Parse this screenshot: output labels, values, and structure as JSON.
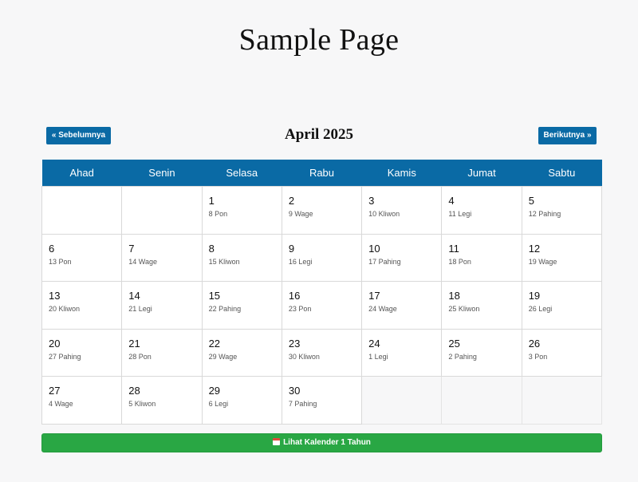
{
  "page": {
    "title": "Sample Page"
  },
  "nav": {
    "prev_label": "« Sebelumnya",
    "next_label": "Berikutnya »",
    "month_label": "April 2025"
  },
  "calendar": {
    "weekdays": [
      "Ahad",
      "Senin",
      "Selasa",
      "Rabu",
      "Kamis",
      "Jumat",
      "Sabtu"
    ],
    "weeks": [
      [
        null,
        null,
        {
          "day": "1",
          "pasaran": "8 Pon"
        },
        {
          "day": "2",
          "pasaran": "9 Wage"
        },
        {
          "day": "3",
          "pasaran": "10 Kliwon"
        },
        {
          "day": "4",
          "pasaran": "11 Legi"
        },
        {
          "day": "5",
          "pasaran": "12 Pahing"
        }
      ],
      [
        {
          "day": "6",
          "pasaran": "13 Pon"
        },
        {
          "day": "7",
          "pasaran": "14 Wage"
        },
        {
          "day": "8",
          "pasaran": "15 Kliwon"
        },
        {
          "day": "9",
          "pasaran": "16 Legi"
        },
        {
          "day": "10",
          "pasaran": "17 Pahing"
        },
        {
          "day": "11",
          "pasaran": "18 Pon"
        },
        {
          "day": "12",
          "pasaran": "19 Wage"
        }
      ],
      [
        {
          "day": "13",
          "pasaran": "20 Kliwon"
        },
        {
          "day": "14",
          "pasaran": "21 Legi"
        },
        {
          "day": "15",
          "pasaran": "22 Pahing"
        },
        {
          "day": "16",
          "pasaran": "23 Pon"
        },
        {
          "day": "17",
          "pasaran": "24 Wage"
        },
        {
          "day": "18",
          "pasaran": "25 Kliwon"
        },
        {
          "day": "19",
          "pasaran": "26 Legi"
        }
      ],
      [
        {
          "day": "20",
          "pasaran": "27 Pahing"
        },
        {
          "day": "21",
          "pasaran": "28 Pon"
        },
        {
          "day": "22",
          "pasaran": "29 Wage"
        },
        {
          "day": "23",
          "pasaran": "30 Kliwon"
        },
        {
          "day": "24",
          "pasaran": "1 Legi"
        },
        {
          "day": "25",
          "pasaran": "2 Pahing"
        },
        {
          "day": "26",
          "pasaran": "3 Pon"
        }
      ],
      [
        {
          "day": "27",
          "pasaran": "4 Wage"
        },
        {
          "day": "28",
          "pasaran": "5 Kliwon"
        },
        {
          "day": "29",
          "pasaran": "6 Legi"
        },
        {
          "day": "30",
          "pasaran": "7 Pahing"
        },
        null,
        null,
        null
      ]
    ]
  },
  "footer": {
    "year_button_icon": "calendar-icon",
    "year_button_label": "Lihat Kalender 1 Tahun"
  },
  "colors": {
    "header_blue": "#0a6aa5",
    "button_green": "#29a744",
    "background": "#f7f7f8"
  }
}
